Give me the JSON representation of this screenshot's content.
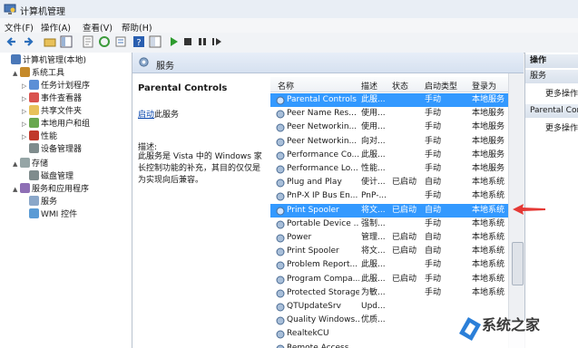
{
  "window": {
    "title": "计算机管理"
  },
  "menubar": {
    "items": [
      "文件(F)",
      "操作(A)",
      "查看(V)",
      "帮助(H)"
    ]
  },
  "tree": {
    "nodes": [
      {
        "label": "计算机管理(本地)",
        "icon": "computer-icon",
        "level": 0,
        "twisty": ""
      },
      {
        "label": "系统工具",
        "icon": "tools-icon",
        "level": 1,
        "twisty": "▲"
      },
      {
        "label": "任务计划程序",
        "icon": "clock-icon",
        "level": 2,
        "twisty": "▷"
      },
      {
        "label": "事件查看器",
        "icon": "event-icon",
        "level": 2,
        "twisty": "▷"
      },
      {
        "label": "共享文件夹",
        "icon": "folder-icon",
        "level": 2,
        "twisty": "▷"
      },
      {
        "label": "本地用户和组",
        "icon": "users-icon",
        "level": 2,
        "twisty": "▷"
      },
      {
        "label": "性能",
        "icon": "performance-icon",
        "level": 2,
        "twisty": "▷"
      },
      {
        "label": "设备管理器",
        "icon": "device-icon",
        "level": 2,
        "twisty": ""
      },
      {
        "label": "存储",
        "icon": "storage-icon",
        "level": 1,
        "twisty": "▲"
      },
      {
        "label": "磁盘管理",
        "icon": "disk-icon",
        "level": 2,
        "twisty": ""
      },
      {
        "label": "服务和应用程序",
        "icon": "apps-icon",
        "level": 1,
        "twisty": "▲"
      },
      {
        "label": "服务",
        "icon": "gear-icon",
        "level": 2,
        "twisty": ""
      },
      {
        "label": "WMI 控件",
        "icon": "wmi-icon",
        "level": 2,
        "twisty": ""
      }
    ]
  },
  "services_panel": {
    "title": "服务",
    "detail": {
      "name": "Parental Controls",
      "action_link": "启动",
      "action_suffix": "此服务",
      "desc_label": "描述:",
      "desc_text": "此服务是 Vista 中的 Windows 家长控制功能的补充，其目的仅仅是为实现向后兼容。"
    },
    "columns": [
      "名称",
      "描述",
      "状态",
      "启动类型",
      "登录为"
    ],
    "rows": [
      {
        "name": "Parental Controls",
        "desc": "此服...",
        "status": "",
        "startup": "手动",
        "logon": "本地服务",
        "selected": true
      },
      {
        "name": "Peer Name Res...",
        "desc": "使用...",
        "status": "",
        "startup": "手动",
        "logon": "本地服务",
        "selected": false
      },
      {
        "name": "Peer Networkin...",
        "desc": "使用...",
        "status": "",
        "startup": "手动",
        "logon": "本地服务",
        "selected": false
      },
      {
        "name": "Peer Networkin...",
        "desc": "向对...",
        "status": "",
        "startup": "手动",
        "logon": "本地服务",
        "selected": false
      },
      {
        "name": "Performance Co...",
        "desc": "此服...",
        "status": "",
        "startup": "手动",
        "logon": "本地服务",
        "selected": false
      },
      {
        "name": "Performance Lo...",
        "desc": "性能...",
        "status": "",
        "startup": "手动",
        "logon": "本地服务",
        "selected": false
      },
      {
        "name": "Plug and Play",
        "desc": "使计...",
        "status": "已启动",
        "startup": "自动",
        "logon": "本地系统",
        "selected": false
      },
      {
        "name": "PnP-X IP Bus En...",
        "desc": "PnP-...",
        "status": "",
        "startup": "手动",
        "logon": "本地系统",
        "selected": false
      },
      {
        "name": "Print Spooler",
        "desc": "将文...",
        "status": "已启动",
        "startup": "自动",
        "logon": "本地系统",
        "selected": true
      },
      {
        "name": "Portable Device ...",
        "desc": "强制...",
        "status": "",
        "startup": "手动",
        "logon": "本地系统",
        "selected": false
      },
      {
        "name": "Power",
        "desc": "管理...",
        "status": "已启动",
        "startup": "自动",
        "logon": "本地系统",
        "selected": false
      },
      {
        "name": "Print Spooler",
        "desc": "将文...",
        "status": "已启动",
        "startup": "自动",
        "logon": "本地系统",
        "selected": false
      },
      {
        "name": "Problem Report...",
        "desc": "此服...",
        "status": "",
        "startup": "手动",
        "logon": "本地系统",
        "selected": false
      },
      {
        "name": "Program Compa...",
        "desc": "此服...",
        "status": "已启动",
        "startup": "手动",
        "logon": "本地系统",
        "selected": false
      },
      {
        "name": "Protected Storage",
        "desc": "为敏...",
        "status": "",
        "startup": "手动",
        "logon": "本地系统",
        "selected": false
      },
      {
        "name": "QTUpdateSrv",
        "desc": "Upd...",
        "status": "",
        "startup": "",
        "logon": "",
        "selected": false
      },
      {
        "name": "Quality Windows...",
        "desc": "优质...",
        "status": "",
        "startup": "",
        "logon": "",
        "selected": false
      },
      {
        "name": "RealtekCU",
        "desc": "",
        "status": "",
        "startup": "",
        "logon": "",
        "selected": false
      },
      {
        "name": "Remote Access ...",
        "desc": "",
        "status": "",
        "startup": "",
        "logon": "",
        "selected": false
      }
    ]
  },
  "actions_panel": {
    "title": "操作",
    "sections": [
      {
        "header": "服务",
        "item": "更多操作"
      },
      {
        "header": "Parental Contr...",
        "item": "更多操作"
      }
    ]
  },
  "watermark": {
    "text": "系统之家"
  },
  "colors": {
    "selection": "#3399ff",
    "arrow": "#e53935"
  }
}
